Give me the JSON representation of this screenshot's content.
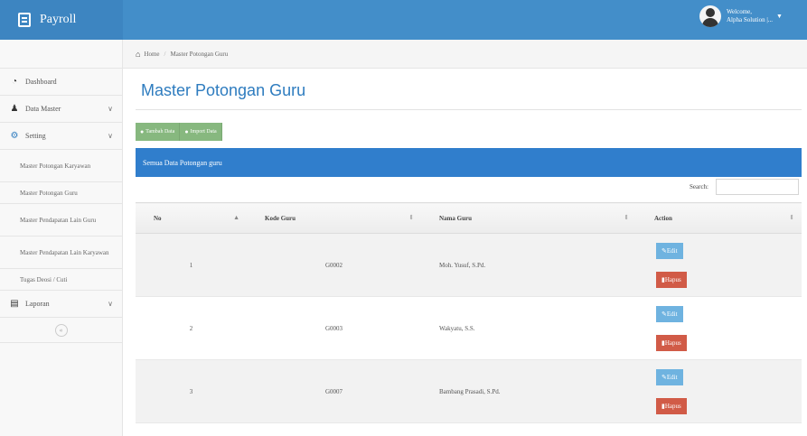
{
  "app": {
    "title": "Payroll"
  },
  "user": {
    "greeting": "Welcome,",
    "name": "Alpha Solution |..."
  },
  "breadcrumb": {
    "home": "Home",
    "current": "Master Potongan Guru"
  },
  "sidebar": {
    "items": [
      {
        "label": "Dashboard"
      },
      {
        "label": "Data Master"
      },
      {
        "label": "Setting"
      }
    ],
    "submenu": [
      {
        "label": "Master Potongan Karyawan"
      },
      {
        "label": "Master Potongan Guru"
      },
      {
        "label": "Master Pendapatan Lain Guru"
      },
      {
        "label": "Master Pendapatan Lain Karyawan"
      },
      {
        "label": "Tugas Deosi / Cuti"
      }
    ],
    "laporan": {
      "label": "Laporan"
    },
    "collapse_icon": "double-chevron-left-icon"
  },
  "page": {
    "title": "Master Potongan Guru"
  },
  "toolbar": {
    "add_label": "Tambah Data",
    "import_label": "Import Data"
  },
  "panel": {
    "header": "Semua Data Potongan guru"
  },
  "search": {
    "label": "Search:",
    "value": ""
  },
  "table": {
    "columns": [
      "No",
      "Kode Guru",
      "Nama Guru",
      "Action"
    ],
    "rows": [
      {
        "no": "1",
        "kode": "G0002",
        "nama": "Moh. Yusuf, S.Pd."
      },
      {
        "no": "2",
        "kode": "G0003",
        "nama": "Wakyatu, S.S."
      },
      {
        "no": "3",
        "kode": "G0007",
        "nama": "Bambang Prasadi, S.Pd."
      }
    ],
    "edit_label": "Edit",
    "hapus_label": "Hapus"
  },
  "colors": {
    "header": "#438ec9",
    "title": "#2e7cbf",
    "panel": "#307ecc",
    "edit": "#6fb3e0",
    "hapus": "#d15b47",
    "green": "#87b87f"
  }
}
